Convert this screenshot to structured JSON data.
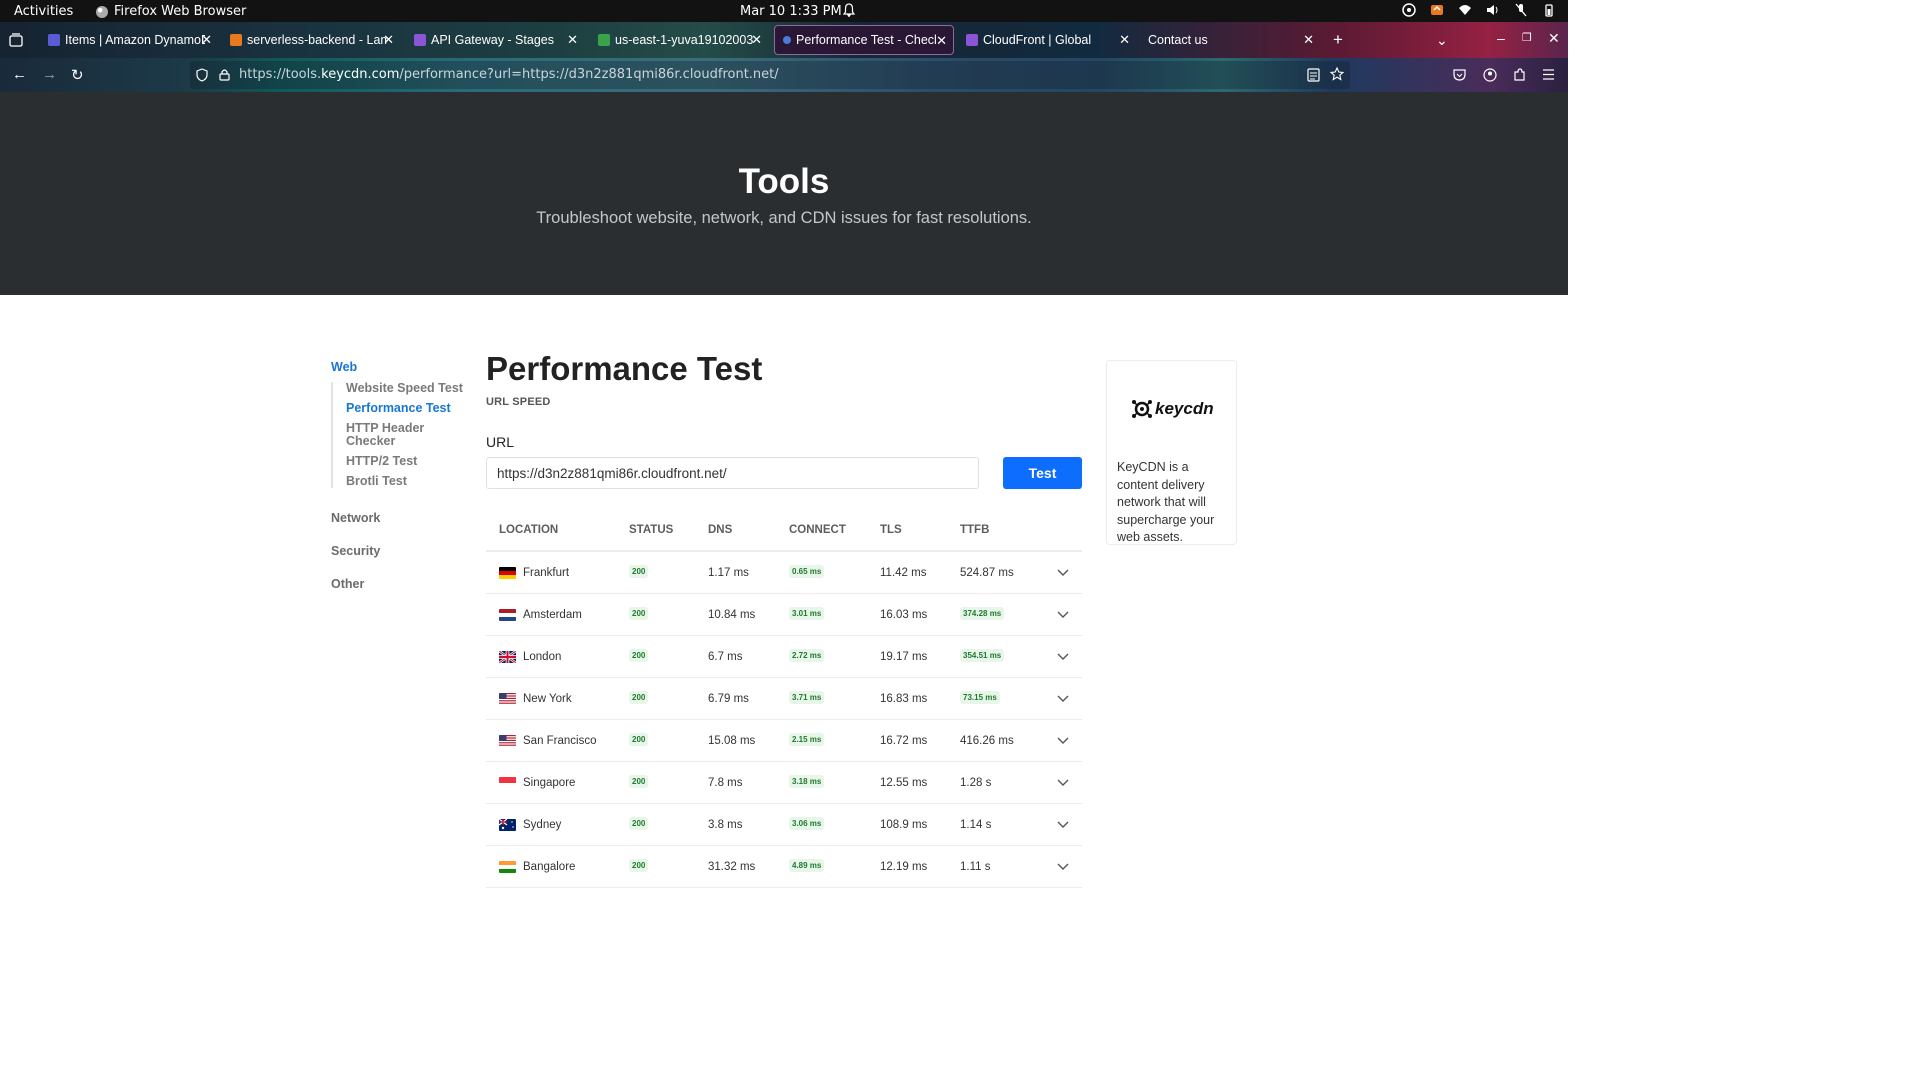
{
  "system": {
    "activities": "Activities",
    "app_name": "Firefox Web Browser",
    "clock": "Mar 10  1:33 PM"
  },
  "tabs": [
    {
      "title": "Items | Amazon DynamoDB",
      "fav_color": "#5b5bd6"
    },
    {
      "title": "serverless-backend - Lambda",
      "fav_color": "#e8791c"
    },
    {
      "title": "API Gateway - Stages",
      "fav_color": "#8a55d6"
    },
    {
      "title": "us-east-1-yuva19102003",
      "fav_color": "#3aa24a"
    },
    {
      "title": "Performance Test - Check",
      "fav_color": "#4a7bd6",
      "active": true
    },
    {
      "title": "CloudFront | Global",
      "fav_color": "#8a55d6"
    },
    {
      "title": "Contact us",
      "fav_color": ""
    }
  ],
  "address": {
    "prefix": "https://tools.",
    "host": "keycdn.com",
    "path": "/performance?url=https://d3n2z881qmi86r.cloudfront.net/"
  },
  "hero": {
    "title": "Tools",
    "subtitle": "Troubleshoot website, network, and CDN issues for fast resolutions."
  },
  "sidebar": {
    "web": "Web",
    "web_items": [
      "Website Speed Test",
      "Performance Test",
      "HTTP Header Checker",
      "HTTP/2 Test",
      "Brotli Test"
    ],
    "network": "Network",
    "security": "Security",
    "other": "Other"
  },
  "main": {
    "title": "Performance Test",
    "subtitle": "URL SPEED",
    "url_label": "URL",
    "url_value": "https://d3n2z881qmi86r.cloudfront.net/",
    "test_button": "Test"
  },
  "table": {
    "headers": [
      "LOCATION",
      "STATUS",
      "DNS",
      "CONNECT",
      "TLS",
      "TTFB"
    ],
    "rows": [
      {
        "location": "Frankfurt",
        "flag": "de",
        "status": "200",
        "dns": "1.17 ms",
        "connect": "0.65 ms",
        "tls": "11.42 ms",
        "ttfb": "524.87 ms",
        "ttfb_badge": false
      },
      {
        "location": "Amsterdam",
        "flag": "nl",
        "status": "200",
        "dns": "10.84 ms",
        "connect": "3.01 ms",
        "tls": "16.03 ms",
        "ttfb": "374.28 ms",
        "ttfb_badge": true
      },
      {
        "location": "London",
        "flag": "gb",
        "status": "200",
        "dns": "6.7 ms",
        "connect": "2.72 ms",
        "tls": "19.17 ms",
        "ttfb": "354.51 ms",
        "ttfb_badge": true
      },
      {
        "location": "New York",
        "flag": "us",
        "status": "200",
        "dns": "6.79 ms",
        "connect": "3.71 ms",
        "tls": "16.83 ms",
        "ttfb": "73.15 ms",
        "ttfb_badge": true
      },
      {
        "location": "San Francisco",
        "flag": "us",
        "status": "200",
        "dns": "15.08 ms",
        "connect": "2.15 ms",
        "tls": "16.72 ms",
        "ttfb": "416.26 ms",
        "ttfb_badge": false
      },
      {
        "location": "Singapore",
        "flag": "sg",
        "status": "200",
        "dns": "7.8 ms",
        "connect": "3.18 ms",
        "tls": "12.55 ms",
        "ttfb": "1.28 s",
        "ttfb_badge": false
      },
      {
        "location": "Sydney",
        "flag": "au",
        "status": "200",
        "dns": "3.8 ms",
        "connect": "3.06 ms",
        "tls": "108.9 ms",
        "ttfb": "1.14 s",
        "ttfb_badge": false
      },
      {
        "location": "Bangalore",
        "flag": "in",
        "status": "200",
        "dns": "31.32 ms",
        "connect": "4.89 ms",
        "tls": "12.19 ms",
        "ttfb": "1.11 s",
        "ttfb_badge": false
      }
    ]
  },
  "card": {
    "brand": "keycdn",
    "text": "KeyCDN is a content delivery network that will supercharge your web assets."
  },
  "colors": {
    "accent": "#0d6efd",
    "link": "#1976d2",
    "hero_bg": "#2b2e31",
    "badge_bg": "#e8f5e9",
    "badge_fg": "#1f7a2e"
  }
}
